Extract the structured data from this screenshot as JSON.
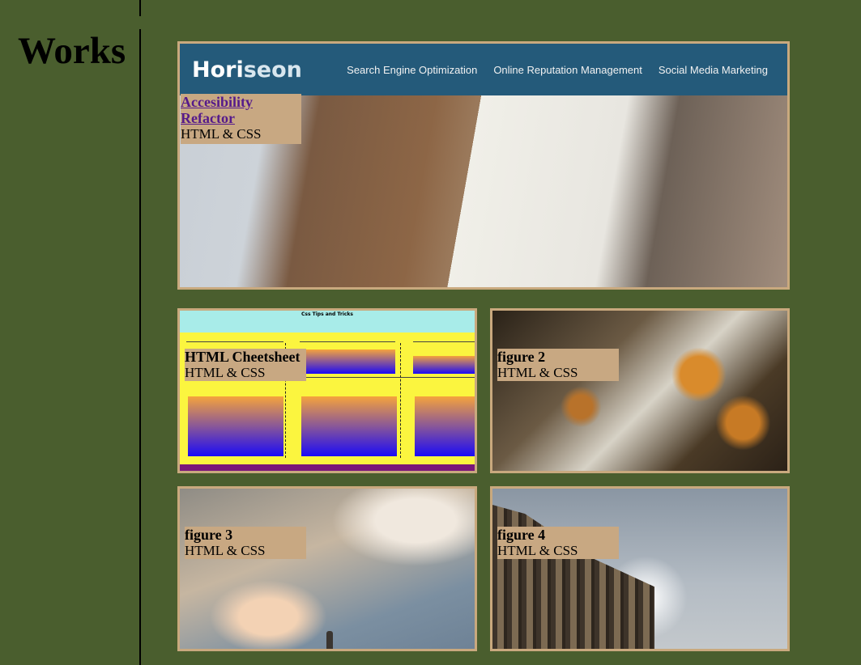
{
  "page": {
    "section_title": "Works"
  },
  "hero": {
    "logo_pre": "Hori",
    "logo_accent": "seon",
    "nav": [
      "Search Engine Optimization",
      "Online Reputation Management",
      "Social Media Marketing"
    ],
    "caption_title_line1": "Accesibility",
    "caption_title_line2": "Refactor",
    "caption_sub": "HTML & CSS"
  },
  "cheatsheet": {
    "header_text": "Css Tips and Tricks",
    "caption_title": "HTML Cheetsheet",
    "caption_sub": "HTML & CSS"
  },
  "figure2": {
    "caption_title": "figure 2",
    "caption_sub": "HTML & CSS"
  },
  "figure3": {
    "caption_title": "figure 3",
    "caption_sub": "HTML & CSS"
  },
  "figure4": {
    "caption_title": "figure 4",
    "caption_sub": "HTML & CSS"
  },
  "colors": {
    "background": "#4a5e2e",
    "card_border": "#c9a97e",
    "caption_bg": "#c8a882",
    "link": "#551a8b",
    "hero_nav_bg": "#245a7a"
  }
}
